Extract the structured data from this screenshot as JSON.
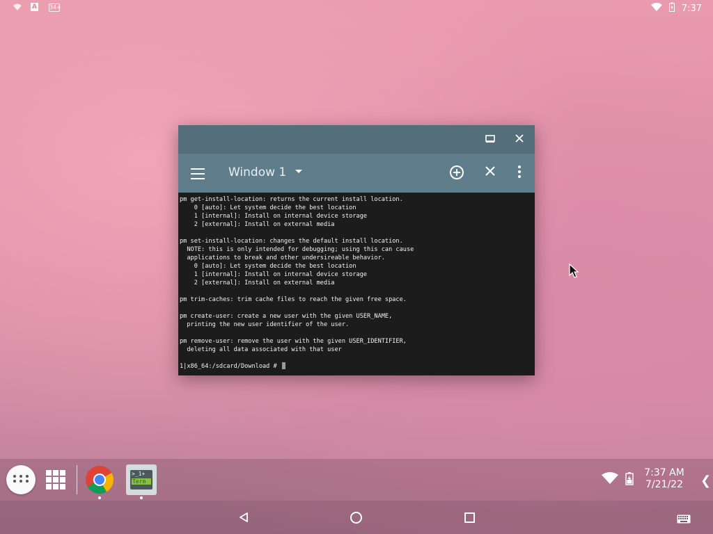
{
  "status_bar": {
    "left_icons": [
      "notification-icon",
      "a-icon",
      "keyboard-box-icon"
    ],
    "a_label": "A",
    "box_label": "34+",
    "right_icons": [
      "wifi-icon",
      "battery-icon"
    ],
    "time": "7:37"
  },
  "window": {
    "title_bar_buttons": [
      "maximize-icon",
      "close-icon"
    ],
    "app_bar": {
      "title": "Window 1",
      "actions": [
        "add-window-icon",
        "close-window-icon",
        "overflow-menu-icon"
      ]
    },
    "terminal": {
      "lines": [
        "pm get-install-location: returns the current install location.",
        "    0 [auto]: Let system decide the best location",
        "    1 [internal]: Install on internal device storage",
        "    2 [external]: Install on external media",
        "",
        "pm set-install-location: changes the default install location.",
        "  NOTE: this is only intended for debugging; using this can cause",
        "  applications to break and other undersireable behavior.",
        "    0 [auto]: Let system decide the best location",
        "    1 [internal]: Install on internal device storage",
        "    2 [external]: Install on external media",
        "",
        "pm trim-caches: trim cache files to reach the given free space.",
        "",
        "pm create-user: create a new user with the given USER_NAME,",
        "  printing the new user identifier of the user.",
        "",
        "pm remove-user: remove the user with the given USER_IDENTIFIER,",
        "  deleting all data associated with that user",
        ""
      ],
      "prompt": "1|x86_64:/sdcard/Download # "
    }
  },
  "taskbar": {
    "apps": [
      "Chrome",
      "Terminal"
    ],
    "term_icon_line1": ">_1+",
    "term_icon_line2": "Term",
    "clock_time": "7:37 AM",
    "clock_date": "7/21/22"
  },
  "navbar": [
    "back-icon",
    "home-icon",
    "recents-icon",
    "keyboard-icon"
  ]
}
